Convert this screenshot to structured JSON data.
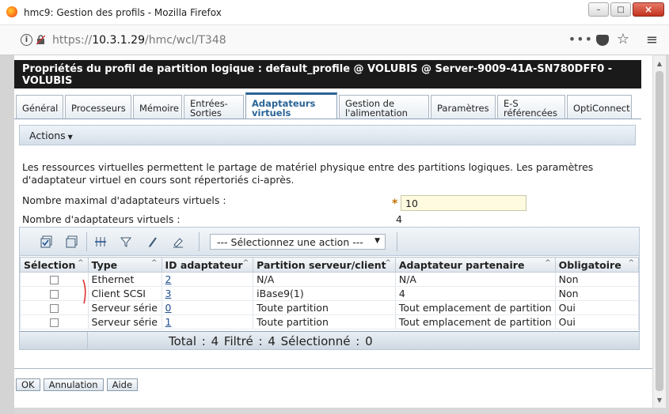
{
  "window": {
    "title": "hmc9: Gestion des profils - Mozilla Firefox",
    "minimize": "–",
    "maximize": "□",
    "close": "×"
  },
  "nav": {
    "url_prefix": "https://",
    "url_host": "10.3.1.29",
    "url_path": "/hmc/wcl/T348",
    "dots": "•••"
  },
  "header": {
    "title": "Propriétés du profil de partition logique : default_profile @ VOLUBIS @ Server-9009-41A-SN780DFF0 - VOLUBIS"
  },
  "tabs": [
    {
      "label": "Général"
    },
    {
      "label": "Processeurs"
    },
    {
      "label": "Mémoire"
    },
    {
      "label": "Entrées-Sorties"
    },
    {
      "label": "Adaptateurs virtuels"
    },
    {
      "label": "Gestion de l'alimentation"
    },
    {
      "label": "Paramètres"
    },
    {
      "label": "E-S référencées"
    },
    {
      "label": "OptiConnect"
    }
  ],
  "actions": {
    "label": "Actions"
  },
  "description": "Les ressources virtuelles permettent le partage de matériel physique entre des partitions logiques. Les paramètres d'adaptateur virtuel en cours sont répertoriés ci-après.",
  "fields": {
    "max_label": "Nombre maximal d'adaptateurs virtuels :",
    "max_required": "*",
    "max_value": "10",
    "count_label": "Nombre d'adaptateurs virtuels :",
    "count_value": "4"
  },
  "toolbar": {
    "select_placeholder": "--- Sélectionnez une action ---"
  },
  "table": {
    "columns": [
      "Sélection",
      "Type",
      "ID adaptateur",
      "Partition serveur/client",
      "Adaptateur partenaire",
      "Obligatoire"
    ],
    "sort_glyph": "^",
    "rows": [
      {
        "type": "Ethernet",
        "id": "2",
        "partition": "N/A",
        "partner": "N/A",
        "required": "Non"
      },
      {
        "type": "Client SCSI",
        "id": "3",
        "partition": "iBase9(1)",
        "partner": "4",
        "required": "Non"
      },
      {
        "type": "Serveur série",
        "id": "0",
        "partition": "Toute partition",
        "partner": "Tout emplacement de partition",
        "required": "Oui"
      },
      {
        "type": "Serveur série",
        "id": "1",
        "partition": "Toute partition",
        "partner": "Tout emplacement de partition",
        "required": "Oui"
      }
    ],
    "totals": "Total : 4   Filtré : 4   Sélectionné : 0"
  },
  "buttons": {
    "ok": "OK",
    "cancel": "Annulation",
    "help": "Aide"
  },
  "colors": {
    "header_bg": "#1a1a1a",
    "active_tab": "#2a6496",
    "link": "#1d4f91",
    "required_star": "#c07000",
    "input_bg": "#fffbe0"
  }
}
